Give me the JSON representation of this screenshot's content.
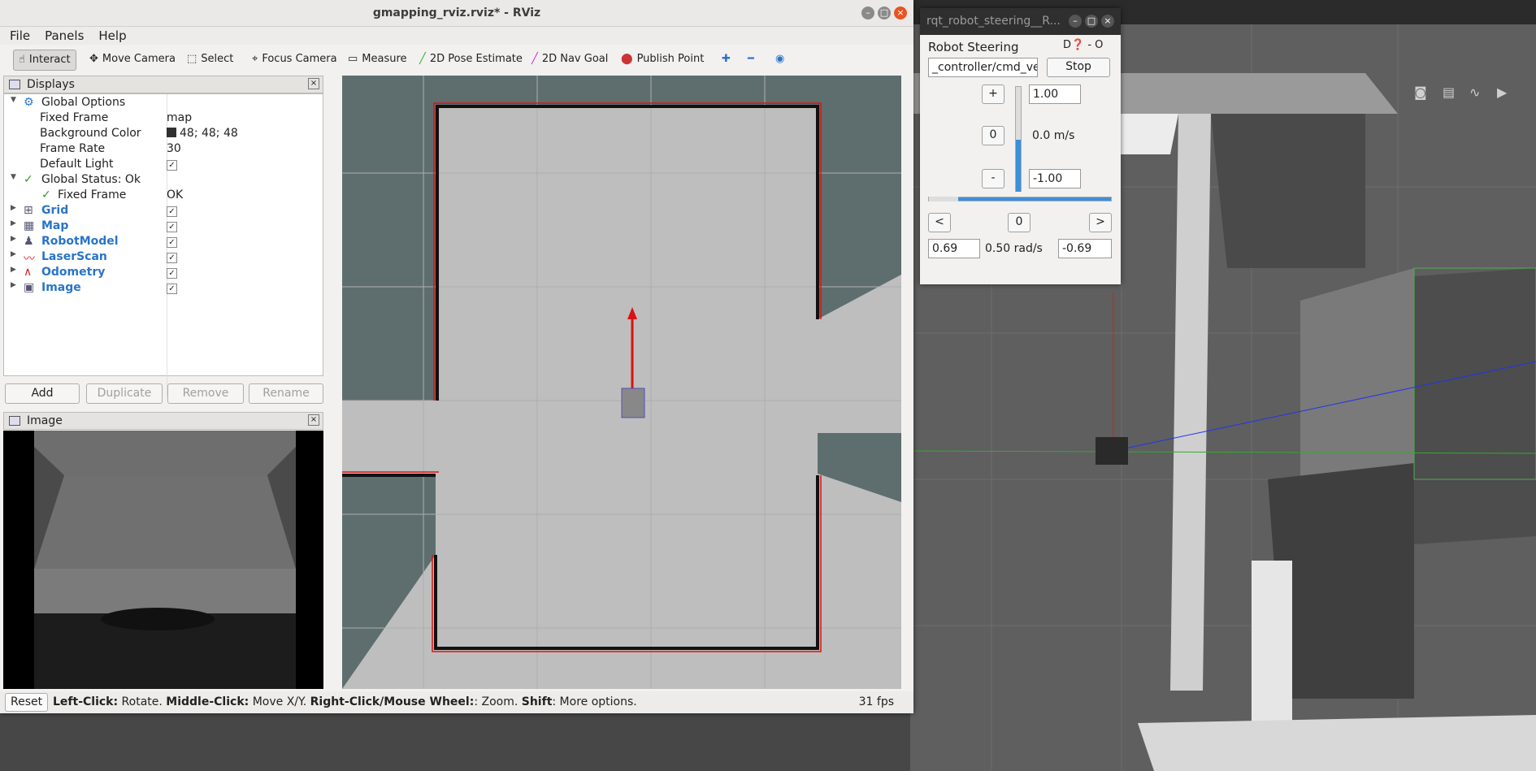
{
  "desktop": {
    "gazebo_scene": "gazebo-3d-view"
  },
  "rviz": {
    "title": "gmapping_rviz.rviz* - RViz",
    "menu": [
      "File",
      "Panels",
      "Help"
    ],
    "toolbar": [
      "Interact",
      "Move Camera",
      "Select",
      "Focus Camera",
      "Measure",
      "2D Pose Estimate",
      "2D Nav Goal",
      "Publish Point"
    ],
    "displays_title": "Displays",
    "global_options": "Global Options",
    "fixed_frame_label": "Fixed Frame",
    "fixed_frame_value": "map",
    "bg_color_label": "Background Color",
    "bg_color_value": "48; 48; 48",
    "frame_rate_label": "Frame Rate",
    "frame_rate_value": "30",
    "default_light_label": "Default Light",
    "global_status": "Global Status: Ok",
    "status_fixed_frame": "Fixed Frame",
    "status_fixed_frame_value": "OK",
    "displays": [
      "Grid",
      "Map",
      "RobotModel",
      "LaserScan",
      "Odometry",
      "Image"
    ],
    "buttons": {
      "add": "Add",
      "duplicate": "Duplicate",
      "remove": "Remove",
      "rename": "Rename"
    },
    "image_title": "Image",
    "status": {
      "reset": "Reset",
      "left_click": "Left-Click:",
      "rotate": " Rotate. ",
      "middle_click": "Middle-Click:",
      "move": " Move X/Y. ",
      "right_click": "Right-Click/Mouse Wheel:",
      "zoom": ": Zoom. ",
      "shift": "Shift",
      "more": ": More options.",
      "fps": "31 fps"
    }
  },
  "steer": {
    "title": "rqt_robot_steering__R...",
    "label": "Robot Steering",
    "topic": "_controller/cmd_vel",
    "stop": "Stop",
    "plus": "+",
    "minus": "-",
    "max_lin": "1.00",
    "min_lin": "-1.00",
    "lin_zero": "0",
    "lin_value": "0.0 m/s",
    "left": "<",
    "right": ">",
    "ang_zero": "0",
    "max_ang": "0.69",
    "ang_value": "0.50 rad/s",
    "min_ang": "-0.69"
  },
  "colors": {
    "accent": "#e95420",
    "map_bg": "#5e6e6e",
    "free": "#bebebe"
  }
}
